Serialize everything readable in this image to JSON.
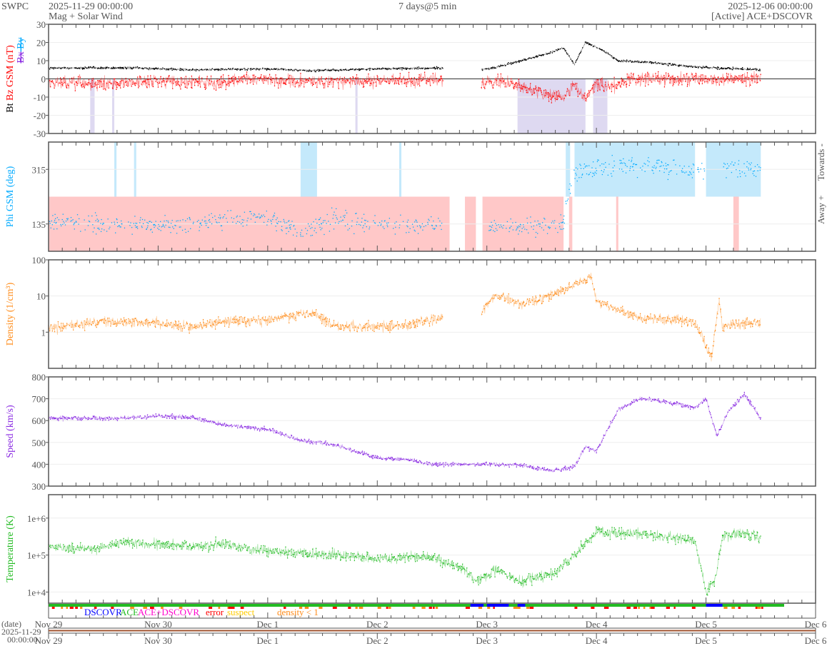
{
  "header": {
    "brand": "SWPC",
    "start_time": "2025-11-29 00:00:00",
    "subtitle": "Mag + Solar Wind",
    "span": "7 days@5 min",
    "end_time": "2025-12-06 00:00:00",
    "source": "[Active] ACE+DSCOVR"
  },
  "chart_data": {
    "type": "line",
    "title": "Mag + Solar Wind",
    "xlim_days": [
      0,
      7
    ],
    "x_ticks": [
      "Nov 29",
      "Nov 30",
      "Dec 1",
      "Dec 2",
      "Dec 3",
      "Dec 4",
      "Dec 5",
      "Dec 6"
    ],
    "date_axis_label": "(date)",
    "date_axis_start": [
      "2025-11-29",
      "00:00:00"
    ],
    "panels": [
      {
        "id": "mag",
        "ylabel_parts": [
          {
            "text": "Bt",
            "color": "#000000"
          },
          {
            "text": "Bz GSM (nT)",
            "color": "#ff0000"
          }
        ],
        "ylabel_parts2": [
          {
            "text": "Bx",
            "color": "#8a2be2"
          },
          {
            "text": "By",
            "color": "#00aaff"
          }
        ],
        "yscale": "linear",
        "ylim": [
          -30,
          30
        ],
        "yticks": [
          -30,
          -20,
          -10,
          0,
          10,
          20,
          30
        ],
        "ytick_labels": [
          "-30",
          "-20",
          "-10",
          "0",
          "10",
          "20",
          "30"
        ],
        "zero_line": true,
        "series": [
          {
            "name": "Bt",
            "color": "#000000",
            "noise": 0.5,
            "points": [
              [
                0,
                6
              ],
              [
                0.8,
                6
              ],
              [
                1,
                5.5
              ],
              [
                1.3,
                5
              ],
              [
                2,
                5.5
              ],
              [
                2.4,
                4.5
              ],
              [
                3,
                5.5
              ],
              [
                3.6,
                6
              ],
              [
                3.66,
                null
              ],
              [
                3.9,
                null
              ],
              [
                3.95,
                5
              ],
              [
                4.05,
                6
              ],
              [
                4.25,
                9
              ],
              [
                4.5,
                13
              ],
              [
                4.7,
                17
              ],
              [
                4.8,
                8
              ],
              [
                4.9,
                20
              ],
              [
                5.05,
                16
              ],
              [
                5.2,
                10
              ],
              [
                5.5,
                9
              ],
              [
                5.8,
                7
              ],
              [
                6.1,
                6
              ],
              [
                6.5,
                5
              ]
            ]
          },
          {
            "name": "Bz",
            "color": "#ff0000",
            "noise": 3,
            "points": [
              [
                0,
                -2
              ],
              [
                0.5,
                -3
              ],
              [
                1,
                -1
              ],
              [
                1.5,
                -2
              ],
              [
                2,
                0
              ],
              [
                2.3,
                -2
              ],
              [
                2.6,
                -1
              ],
              [
                3,
                -1
              ],
              [
                3.3,
                -1
              ],
              [
                3.6,
                -1
              ],
              [
                3.66,
                null
              ],
              [
                3.9,
                null
              ],
              [
                3.95,
                -3
              ],
              [
                4.1,
                -1
              ],
              [
                4.3,
                -4
              ],
              [
                4.5,
                -8
              ],
              [
                4.7,
                -10
              ],
              [
                4.8,
                -3
              ],
              [
                4.9,
                -12
              ],
              [
                5.0,
                -2
              ],
              [
                5.1,
                -5
              ],
              [
                5.3,
                0
              ],
              [
                5.6,
                0
              ],
              [
                5.9,
                0
              ],
              [
                6.2,
                -1
              ],
              [
                6.5,
                1
              ]
            ]
          }
        ],
        "shading": {
          "color": "#c8bfe8",
          "intervals": [
            [
              0.38,
              0.42
            ],
            [
              0.58,
              0.6
            ],
            [
              2.8,
              2.82
            ],
            [
              4.28,
              4.9
            ],
            [
              4.97,
              5.1
            ]
          ]
        }
      },
      {
        "id": "phi",
        "ylabel_parts": [
          {
            "text": "Phi GSM (deg)",
            "color": "#00aaff"
          }
        ],
        "right_labels": [
          "Towards -",
          "Away +"
        ],
        "yscale": "linear",
        "ylim": [
          45,
          405
        ],
        "yticks": [
          135,
          315
        ],
        "ytick_labels": [
          "135",
          "315"
        ],
        "series": [
          {
            "name": "Phi",
            "color": "#00aaff",
            "noise": 25,
            "dots_only": true,
            "points": [
              [
                0,
                140
              ],
              [
                0.6,
                135
              ],
              [
                1,
                130
              ],
              [
                1.5,
                145
              ],
              [
                2,
                160
              ],
              [
                2.3,
                110
              ],
              [
                2.6,
                150
              ],
              [
                3,
                140
              ],
              [
                3.3,
                125
              ],
              [
                3.6,
                140
              ],
              [
                3.66,
                null
              ],
              [
                3.88,
                null
              ],
              [
                3.9,
                140
              ],
              [
                3.95,
                null
              ],
              [
                4.0,
                null
              ],
              [
                4.02,
                125
              ],
              [
                4.4,
                130
              ],
              [
                4.7,
                140
              ],
              [
                4.72,
                200
              ],
              [
                4.8,
                310
              ],
              [
                5.2,
                320
              ],
              [
                5.5,
                325
              ],
              [
                6.0,
                310
              ],
              [
                6.1,
                null
              ],
              [
                6.15,
                310
              ],
              [
                6.5,
                320
              ]
            ]
          }
        ],
        "away_intervals": [
          [
            0,
            3.66
          ],
          [
            3.8,
            3.9
          ],
          [
            3.96,
            4.7
          ],
          [
            4.75,
            4.78
          ],
          [
            5.18,
            5.2
          ],
          [
            6.25,
            6.3
          ]
        ],
        "toward_intervals": [
          [
            0.6,
            0.62
          ],
          [
            0.78,
            0.8
          ],
          [
            2.3,
            2.45
          ],
          [
            3.2,
            3.22
          ],
          [
            4.72,
            4.76
          ],
          [
            4.8,
            5.9
          ],
          [
            6.0,
            6.5
          ]
        ]
      },
      {
        "id": "density",
        "ylabel_parts": [
          {
            "text": "Density (1/cm³)",
            "color": "#ff8c1a"
          }
        ],
        "yscale": "log",
        "ylim": [
          0.1,
          100
        ],
        "yticks": [
          1,
          10,
          100
        ],
        "ytick_labels": [
          "1",
          "10",
          "100"
        ],
        "series": [
          {
            "name": "Density",
            "color": "#ff8c1a",
            "noise": 0.12,
            "points": [
              [
                0,
                1.3
              ],
              [
                0.5,
                2
              ],
              [
                1,
                1.8
              ],
              [
                1.3,
                1.4
              ],
              [
                1.6,
                2
              ],
              [
                2,
                2.2
              ],
              [
                2.4,
                3.5
              ],
              [
                2.6,
                1.5
              ],
              [
                3,
                1.4
              ],
              [
                3.3,
                1.6
              ],
              [
                3.6,
                2.5
              ],
              [
                3.66,
                null
              ],
              [
                3.9,
                null
              ],
              [
                3.95,
                3.5
              ],
              [
                4.05,
                9
              ],
              [
                4.15,
                10
              ],
              [
                4.3,
                6
              ],
              [
                4.5,
                8
              ],
              [
                4.7,
                15
              ],
              [
                4.95,
                35
              ],
              [
                5.0,
                7
              ],
              [
                5.2,
                4
              ],
              [
                5.4,
                2.5
              ],
              [
                5.9,
                2
              ],
              [
                6.0,
                0.4
              ],
              [
                6.05,
                0.2
              ],
              [
                6.12,
                8
              ],
              [
                6.15,
                1.5
              ],
              [
                6.5,
                1.8
              ]
            ]
          }
        ]
      },
      {
        "id": "speed",
        "ylabel_parts": [
          {
            "text": "Speed (km/s)",
            "color": "#8a2be2"
          }
        ],
        "yscale": "linear",
        "ylim": [
          300,
          800
        ],
        "yticks": [
          300,
          400,
          500,
          600,
          700,
          800
        ],
        "ytick_labels": [
          "300",
          "400",
          "500",
          "600",
          "700",
          "800"
        ],
        "series": [
          {
            "name": "Speed",
            "color": "#8a2be2",
            "noise": 8,
            "points": [
              [
                0,
                610
              ],
              [
                0.5,
                610
              ],
              [
                1,
                620
              ],
              [
                1.3,
                615
              ],
              [
                1.6,
                580
              ],
              [
                2,
                560
              ],
              [
                2.3,
                510
              ],
              [
                2.6,
                490
              ],
              [
                3,
                430
              ],
              [
                3.3,
                420
              ],
              [
                3.5,
                400
              ],
              [
                4,
                400
              ],
              [
                4.3,
                395
              ],
              [
                4.6,
                370
              ],
              [
                4.8,
                390
              ],
              [
                4.9,
                480
              ],
              [
                5.0,
                460
              ],
              [
                5.1,
                560
              ],
              [
                5.2,
                650
              ],
              [
                5.4,
                700
              ],
              [
                5.6,
                690
              ],
              [
                5.9,
                660
              ],
              [
                6.0,
                700
              ],
              [
                6.1,
                530
              ],
              [
                6.2,
                640
              ],
              [
                6.35,
                720
              ],
              [
                6.5,
                610
              ]
            ]
          }
        ]
      },
      {
        "id": "temperature",
        "ylabel_parts": [
          {
            "text": "Temperature (K)",
            "color": "#22bb22"
          }
        ],
        "yscale": "log",
        "ylim": [
          5000,
          4300000
        ],
        "yticks": [
          10000,
          100000,
          1000000
        ],
        "ytick_labels": [
          "1e+4",
          "1e+5",
          "1e+6"
        ],
        "series": [
          {
            "name": "Temperature",
            "color": "#22bb22",
            "noise": 0.12,
            "points": [
              [
                0,
                170000
              ],
              [
                0.4,
                140000
              ],
              [
                0.7,
                220000
              ],
              [
                1,
                200000
              ],
              [
                1.3,
                170000
              ],
              [
                1.6,
                200000
              ],
              [
                2,
                130000
              ],
              [
                2.5,
                100000
              ],
              [
                3,
                80000
              ],
              [
                3.5,
                90000
              ],
              [
                3.8,
                40000
              ],
              [
                3.9,
                20000
              ],
              [
                4.1,
                40000
              ],
              [
                4.3,
                20000
              ],
              [
                4.6,
                30000
              ],
              [
                4.8,
                100000
              ],
              [
                5.0,
                450000
              ],
              [
                5.5,
                350000
              ],
              [
                5.9,
                250000
              ],
              [
                6.0,
                10000
              ],
              [
                6.08,
                20000
              ],
              [
                6.15,
                300000
              ],
              [
                6.3,
                400000
              ],
              [
                6.5,
                300000
              ]
            ]
          }
        ]
      }
    ],
    "source_bar": {
      "legend": [
        {
          "text": "DSCOVR",
          "color": "#0000ff"
        },
        {
          "text": "ACE",
          "color": "#22bb22"
        },
        {
          "text": "ACE+DSCOVR",
          "color": "#ff00cc"
        },
        {
          "text": "error",
          "color": "#ff0000"
        },
        {
          "text": "suspect",
          "color": "#ffcc00"
        },
        {
          "text": "density < 1",
          "color": "#ff8c1a"
        }
      ],
      "dscovr_intervals": [
        [
          3.85,
          3.97
        ],
        [
          4.0,
          4.2
        ],
        [
          4.28,
          4.35
        ],
        [
          6.0,
          6.15
        ]
      ],
      "active_color": "#22bb22"
    }
  }
}
